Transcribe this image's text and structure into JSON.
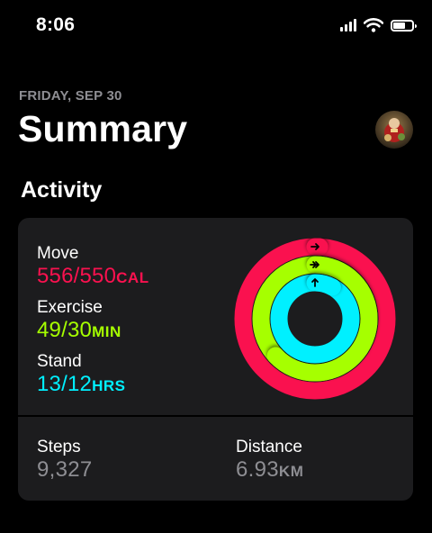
{
  "status_bar": {
    "time": "8:06",
    "icons": [
      "cellular-signal-icon",
      "wifi-icon",
      "battery-icon"
    ],
    "battery_level": 0.6
  },
  "header": {
    "date": "FRIDAY, SEP 30",
    "title": "Summary"
  },
  "activity": {
    "section_title": "Activity",
    "move": {
      "label": "Move",
      "value": "556/550",
      "unit": "CAL",
      "color": "#fa114f",
      "progress": 1.01
    },
    "exercise": {
      "label": "Exercise",
      "value": "49/30",
      "unit": "MIN",
      "color": "#a6ff00",
      "progress": 1.63
    },
    "stand": {
      "label": "Stand",
      "value": "13/12",
      "unit": "HRS",
      "color": "#00f0ff",
      "progress": 1.08
    }
  },
  "stats": {
    "steps": {
      "label": "Steps",
      "value": "9,327"
    },
    "distance": {
      "label": "Distance",
      "value": "6.93",
      "unit": "KM"
    }
  }
}
